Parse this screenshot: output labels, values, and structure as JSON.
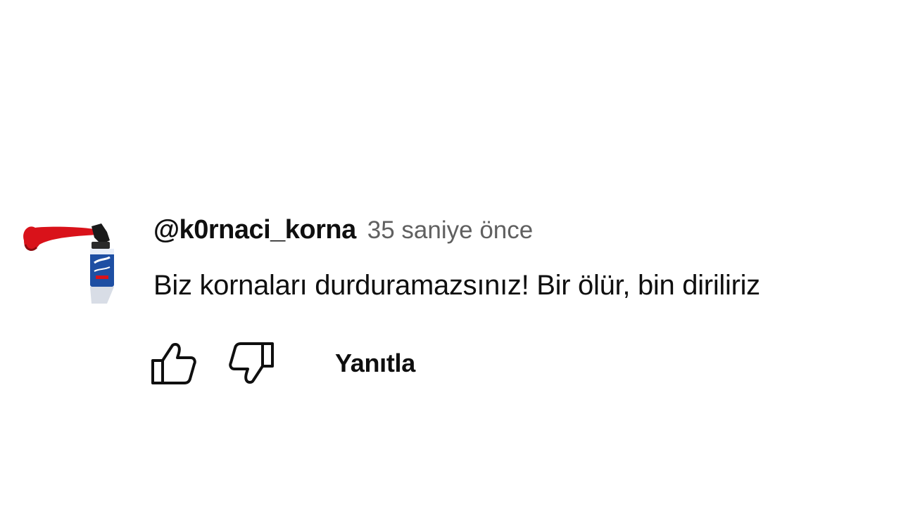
{
  "comment": {
    "author": "@k0rnaci_korna",
    "timestamp": "35 saniye önce",
    "text": "Biz kornaları durduramazsınız! Bir ölür, bin diriliriz",
    "avatar_icon": "air-horn-icon"
  },
  "actions": {
    "like_icon": "thumbs-up-icon",
    "dislike_icon": "thumbs-down-icon",
    "reply_label": "Yanıtla"
  },
  "colors": {
    "text_primary": "#0f0f0f",
    "text_secondary": "#606060",
    "horn_red": "#d9121a",
    "can_blue": "#1e4fa3"
  }
}
